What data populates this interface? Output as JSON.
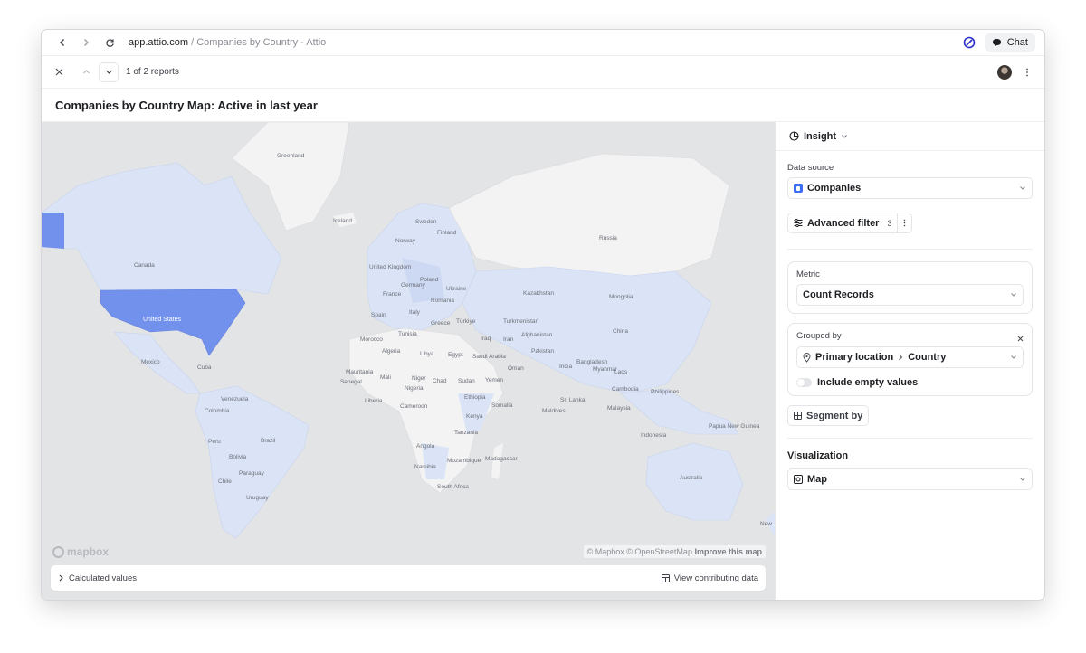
{
  "browser": {
    "domain": "app.attio.com",
    "separator": "/",
    "page_title": "Companies by Country - Attio",
    "chat_label": "Chat"
  },
  "report_nav": {
    "counter": "1 of 2 reports"
  },
  "report": {
    "title": "Companies by Country Map: Active in last year"
  },
  "map": {
    "labels": {
      "greenland": "Greenland",
      "iceland": "Iceland",
      "sweden": "Sweden",
      "finland": "Finland",
      "norway": "Norway",
      "russia": "Russia",
      "canada": "Canada",
      "united_kingdom": "United Kingdom",
      "poland": "Poland",
      "germany": "Germany",
      "ukraine": "Ukraine",
      "france": "France",
      "romania": "Romania",
      "spain": "Spain",
      "italy": "Italy",
      "greece": "Greece",
      "turkiye": "Türkiye",
      "kazakhstan": "Kazakhstan",
      "mongolia": "Mongolia",
      "turkmenistan": "Turkmenistan",
      "iraq": "Iraq",
      "iran": "Iran",
      "afghanistan": "Afghanistan",
      "pakistan": "Pakistan",
      "china": "China",
      "united_states": "United States",
      "morocco": "Morocco",
      "tunisia": "Tunisia",
      "algeria": "Algeria",
      "libya": "Libya",
      "egypt": "Egypt",
      "saudi_arabia": "Saudi Arabia",
      "oman": "Oman",
      "india": "India",
      "bangladesh": "Bangladesh",
      "myanmar": "Myanmar",
      "laos": "Laos",
      "mexico": "Mexico",
      "cuba": "Cuba",
      "mauritania": "Mauritania",
      "mali": "Mali",
      "niger": "Niger",
      "chad": "Chad",
      "sudan": "Sudan",
      "yemen": "Yemen",
      "senegal": "Senegal",
      "nigeria": "Nigeria",
      "ethiopia": "Ethiopia",
      "sri_lanka": "Sri Lanka",
      "cambodia": "Cambodia",
      "philippines": "Philippines",
      "venezuela": "Venezuela",
      "colombia": "Colombia",
      "liberia": "Liberia",
      "cameroon": "Cameroon",
      "somalia": "Somalia",
      "malaysia": "Malaysia",
      "maldives": "Maldives",
      "kenya": "Kenya",
      "tanzania": "Tanzania",
      "papua_new_guinea": "Papua New Guinea",
      "peru": "Peru",
      "brazil": "Brazil",
      "indonesia": "Indonesia",
      "angola": "Angola",
      "bolivia": "Bolivia",
      "namibia": "Namibia",
      "mozambique": "Mozambique",
      "madagascar": "Madagascar",
      "australia": "Australia",
      "paraguay": "Paraguay",
      "chile": "Chile",
      "south_africa": "South Africa",
      "uruguay": "Uruguay",
      "new": "New"
    },
    "attribution": "© Mapbox © OpenStreetMap",
    "improve": "Improve this map",
    "logo": "mapbox",
    "highlight_color": "#7191ec",
    "tint_color": "#dbe4f6"
  },
  "footer": {
    "calculated_values": "Calculated values",
    "view_contributing": "View contributing data"
  },
  "panel": {
    "insight_label": "Insight",
    "data_source_label": "Data source",
    "data_source_value": "Companies",
    "advanced_filter_label": "Advanced filter",
    "advanced_filter_count": "3",
    "metric_label": "Metric",
    "metric_value": "Count Records",
    "grouped_by_label": "Grouped by",
    "grouped_by_field": "Primary location",
    "grouped_by_subfield": "Country",
    "include_empty_label": "Include empty values",
    "segment_by_label": "Segment by",
    "visualization_label": "Visualization",
    "visualization_value": "Map"
  }
}
